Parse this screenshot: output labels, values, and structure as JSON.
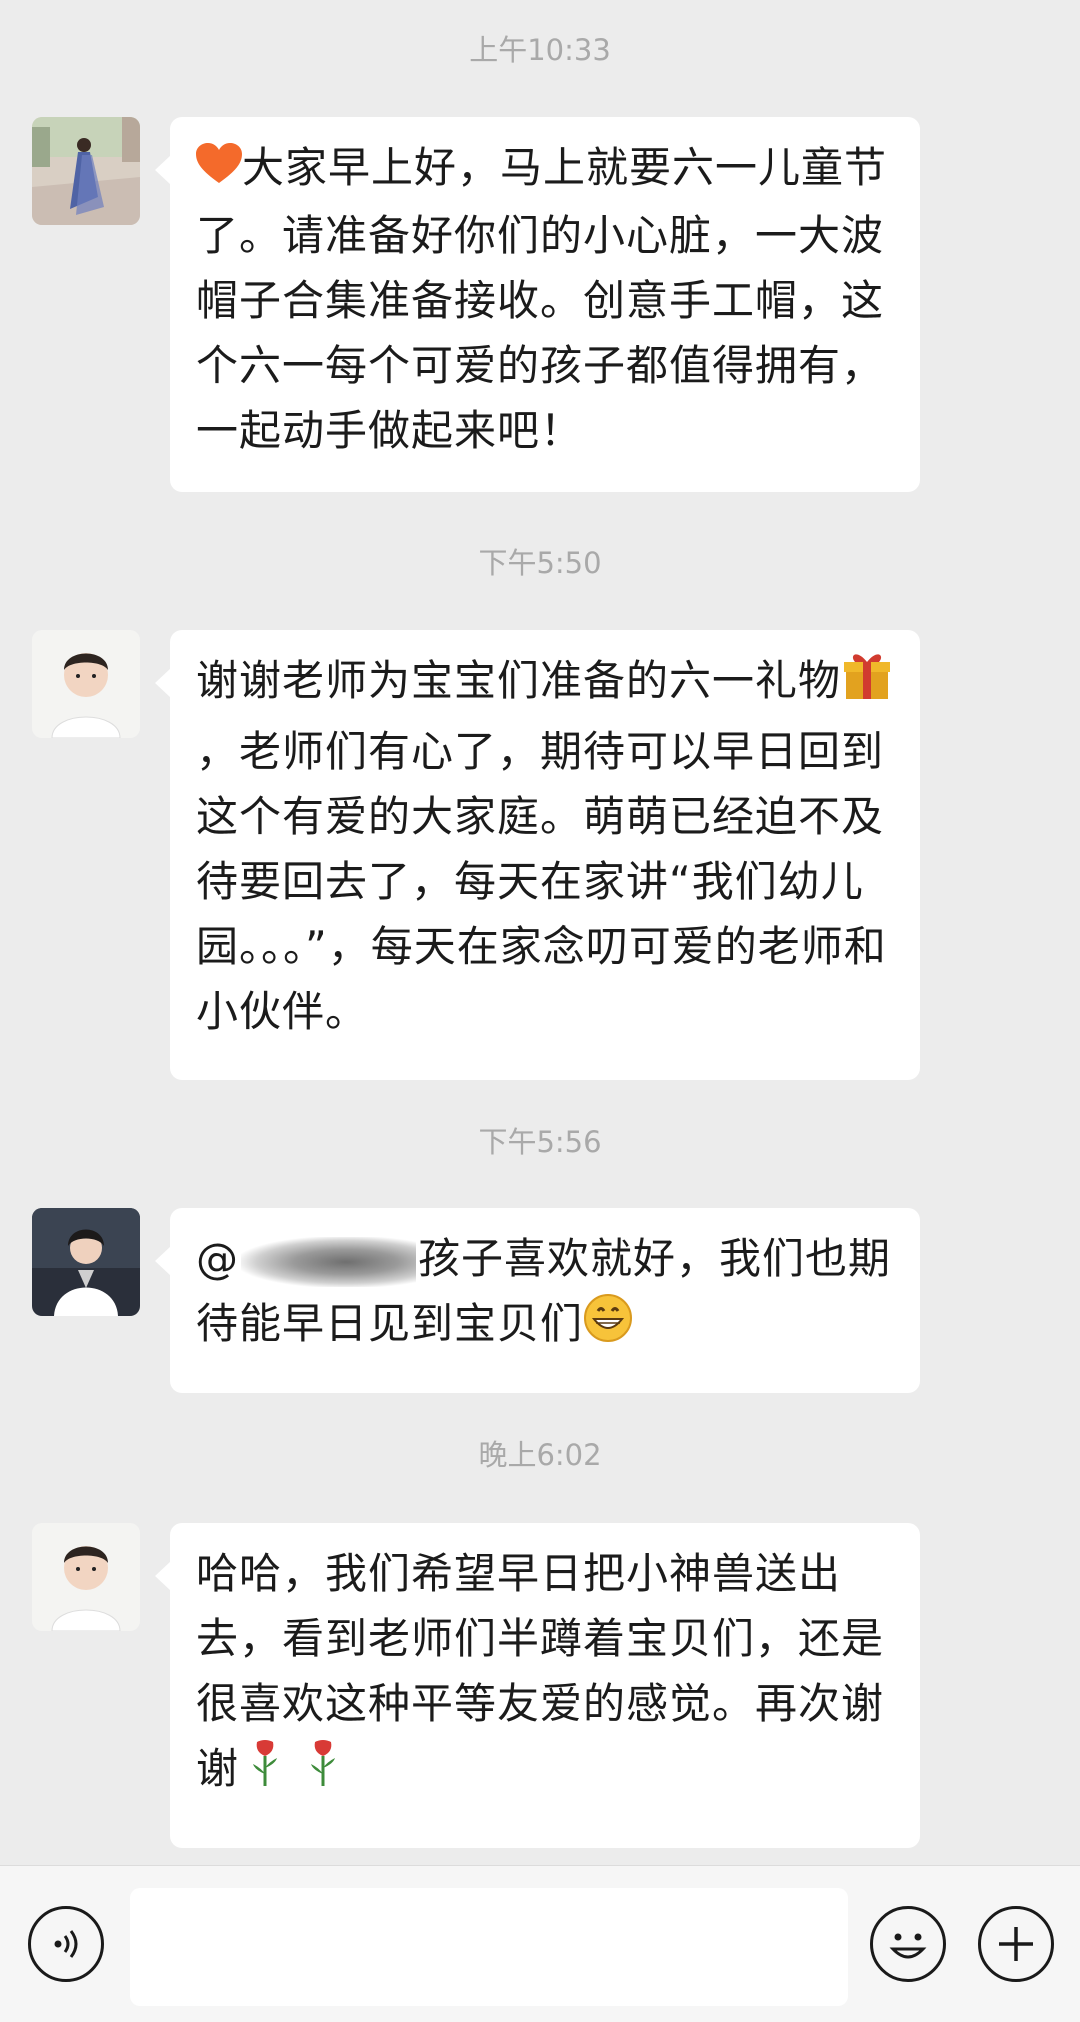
{
  "messages": [
    {
      "timestamp": "上午10:33",
      "avatar": "woman-in-dress-photo",
      "text": "大家早上好，马上就要六一儿童节了。请准备好你们的小心脏，一大波帽子合集准备接收。创意手工帽，这个六一每个可爱的孩子都值得拥有，一起动手做起来吧！",
      "leading_emoji": "orange-heart"
    },
    {
      "timestamp": "下午5:50",
      "avatar": "child-photo",
      "text_part1": "谢谢老师为宝宝们准备的六一礼物",
      "text_part2": "，老师们有心了，期待可以早日回到这个有爱的大家庭。萌萌已经迫不及待要回去了，每天在家讲“我们幼儿园。。。”，每天在家念叨可爱的老师和小伙伴。",
      "inline_emoji": "gift"
    },
    {
      "timestamp": "下午5:56",
      "avatar": "teacher-photo",
      "mention_prefix": "@",
      "text": "孩子喜欢就好，我们也期待能早日见到宝贝们",
      "trailing_emoji": "grin"
    },
    {
      "timestamp": "晚上6:02",
      "avatar": "child-photo",
      "text": "哈哈，我们希望早日把小神兽送出去，看到老师们半蹲着宝贝们，还是很喜欢这种平等友爱的感觉。再次谢谢",
      "trailing_emoji": "rose x2"
    }
  ],
  "input_bar": {
    "voice_icon": "voice-icon",
    "emoji_icon": "emoji-face-icon",
    "plus_icon": "plus-icon",
    "input_value": ""
  }
}
